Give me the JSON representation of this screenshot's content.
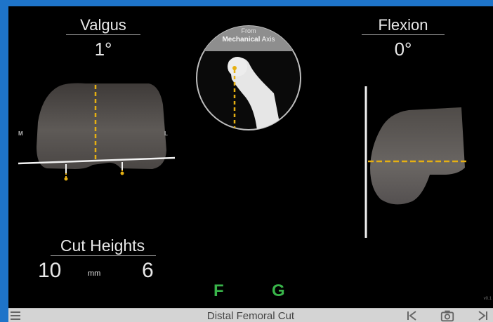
{
  "valgus": {
    "label": "Valgus",
    "value": "1°"
  },
  "flexion": {
    "label": "Flexion",
    "value": "0°"
  },
  "inset": {
    "line1": "From",
    "line2_bold": "Mechanical",
    "line2_rest": " Axis"
  },
  "markers": {
    "medial": "M",
    "lateral": "L"
  },
  "cut_heights": {
    "label": "Cut Heights",
    "medial_value": "10",
    "unit": "mm",
    "lateral_value": "6"
  },
  "status": {
    "left": "F",
    "right": "G"
  },
  "version": "v0.1",
  "bottom_bar": {
    "title": "Distal Femoral Cut"
  },
  "icons": {
    "menu": "menu-icon",
    "previous": "skip-previous-icon",
    "camera": "camera-icon",
    "next": "skip-next-icon"
  },
  "colors": {
    "frame": "#1E74C9",
    "guide_line": "#E6B012",
    "status_green": "#39B54A",
    "bar": "#D4D4D4"
  }
}
